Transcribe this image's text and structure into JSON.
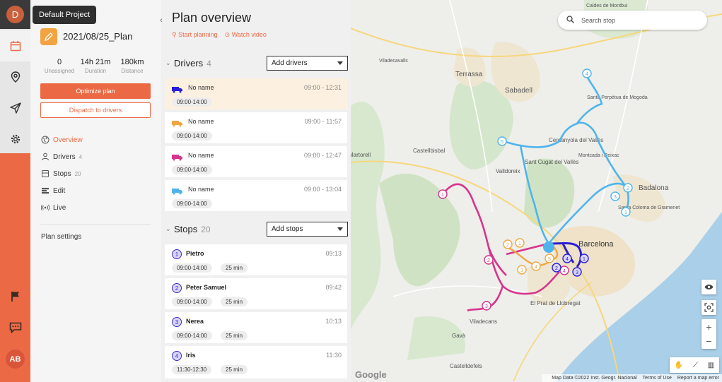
{
  "project": {
    "avatar": "D",
    "tooltip": "Default Project",
    "user_avatar": "AB"
  },
  "rail": {
    "icons": [
      "calendar-icon",
      "location-pin-icon",
      "send-icon",
      "gear-icon",
      "flag-icon",
      "chat-icon"
    ]
  },
  "plan": {
    "name": "2021/08/25_Plan",
    "stats": [
      {
        "value": "0",
        "label": "Unassigned"
      },
      {
        "value": "14h 21m",
        "label": "Duration"
      },
      {
        "value": "180km",
        "label": "Distance"
      }
    ],
    "optimize_label": "Optimize plan",
    "dispatch_label": "Dispatch to drivers"
  },
  "nav": {
    "overview": "Overview",
    "drivers": "Drivers",
    "drivers_count": "4",
    "stops": "Stops",
    "stops_count": "20",
    "edit": "Edit",
    "live": "Live",
    "settings": "Plan settings"
  },
  "overview": {
    "title": "Plan overview",
    "start_planning": "Start planning",
    "watch_video": "Watch video",
    "drivers_header": "Drivers",
    "drivers_count": "4",
    "add_drivers": "Add drivers",
    "stops_header": "Stops",
    "stops_count": "20",
    "add_stops": "Add stops"
  },
  "drivers": [
    {
      "name": "No name",
      "time": "09:00 - 12:31",
      "window": "09:00-14:00",
      "color": "#2a1fd6"
    },
    {
      "name": "No name",
      "time": "09:00 - 11:57",
      "window": "09:00-14:00",
      "color": "#f0a742"
    },
    {
      "name": "No name",
      "time": "09:00 - 12:47",
      "window": "09:00-14:00",
      "color": "#d6358d"
    },
    {
      "name": "No name",
      "time": "09:00 - 13:04",
      "window": "09:00-14:00",
      "color": "#4fb4ec"
    }
  ],
  "stops": [
    {
      "num": "1",
      "name": "Pietro",
      "eta": "09:13",
      "window": "09:00-14:00",
      "duration": "25 min"
    },
    {
      "num": "2",
      "name": "Peter Samuel",
      "eta": "09:42",
      "window": "09:00-14:00",
      "duration": "25 min"
    },
    {
      "num": "3",
      "name": "Nerea",
      "eta": "10:13",
      "window": "09:00-14:00",
      "duration": "25 min"
    },
    {
      "num": "4",
      "name": "Iris",
      "eta": "11:30",
      "window": "11:30-12:30",
      "duration": "25 min"
    }
  ],
  "map": {
    "search_placeholder": "Search stop",
    "google": "Google",
    "attribution": "Map Data ©2022 Inst. Geogr. Nacional",
    "terms": "Terms of Use",
    "report": "Report a map error",
    "places": {
      "sabadell": "Sabadell",
      "terrassa": "Terrassa",
      "badalona": "Badalona",
      "barcelona": "Barcelona",
      "castellbisbal": "Castellbisbal",
      "martorell": "Martorell",
      "cerdanyola": "Cerdanyola del Vallès",
      "sant_cugat": "Sant Cugat del Vallès",
      "el_prat": "El Prat de Llobregat",
      "gava": "Gavà",
      "viladecans": "Viladecans",
      "castelldefels": "Castelldefels",
      "valldoreix": "Valldoreix",
      "santa_perpetua": "Santa Perpètua de Mogoda",
      "viladecavalls": "Viladecavalls",
      "santa_coloma": "Santa Coloma de Gramenet",
      "caldes": "Caldes de Montbui",
      "montcada": "Montcada i Reixac"
    }
  }
}
